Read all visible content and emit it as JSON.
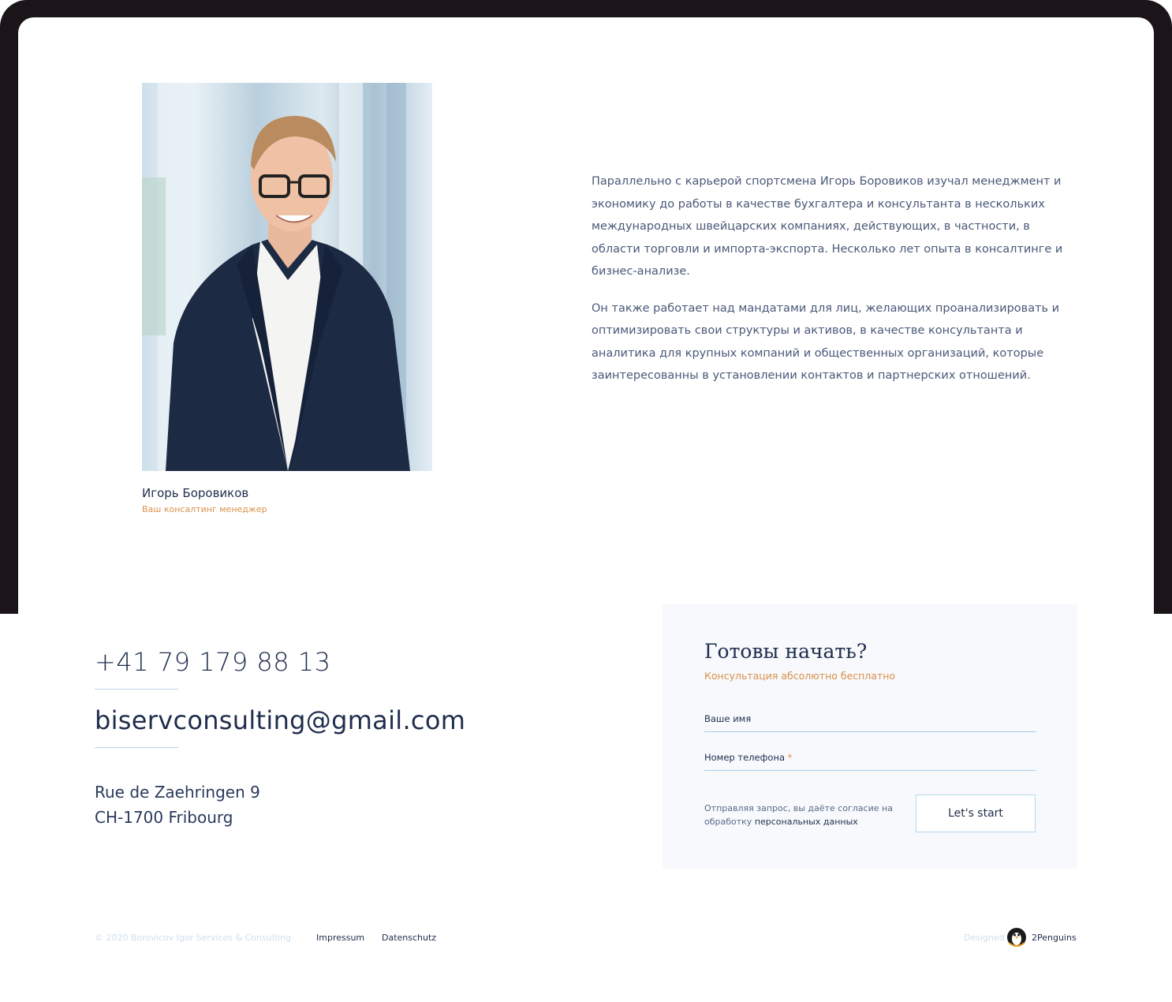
{
  "profile": {
    "name": "Игорь Боровиков",
    "role": "Ваш консалтинг менеджер"
  },
  "bio": {
    "paragraphs": [
      "Параллельно с карьерой спортсмена Игорь Боровиков изучал менеджмент и экономику до работы в качестве бухгалтера и консультанта в нескольких международных швейцарских компаниях, действующих, в частности, в области торговли и импорта-экспорта. Несколько лет опыта в  консалтинге и бизнес-анализе.",
      "Он также работает над мандатами для лиц, желающих проанализировать и оптимизировать свои структуры и активов, в качестве консультанта и аналитика для крупных компаний и общественных организаций,  которые заинтересованны в установлении контактов и партнерских отношений."
    ]
  },
  "contacts": {
    "phone": "+41 79 179 88 13",
    "email": "biservconsulting@gmail.com",
    "address_line1": "Rue de Zaehringen 9",
    "address_line2": "CH-1700 Fribourg"
  },
  "form": {
    "title": "Готовы начать?",
    "subtitle": "Консультация абсолютно бесплатно",
    "name_label": "Ваше имя",
    "phone_label": "Номер телефона",
    "required_mark": "*",
    "consent_text": "Отправляя запрос, вы даёте согласие на обработку",
    "consent_link": "персональных данных",
    "submit_label": "Let's start"
  },
  "footer": {
    "copyright": "© 2020 Borovicov Igor Services & Consulting",
    "impressum": "Impressum",
    "datenschutz": "Datenschutz",
    "designed": "Designed",
    "brand": "2Penguins"
  },
  "colors": {
    "frame": "#1b1419",
    "accent": "#d9904a",
    "text_dark": "#1f2d4d",
    "field_line": "#a9cce6"
  }
}
